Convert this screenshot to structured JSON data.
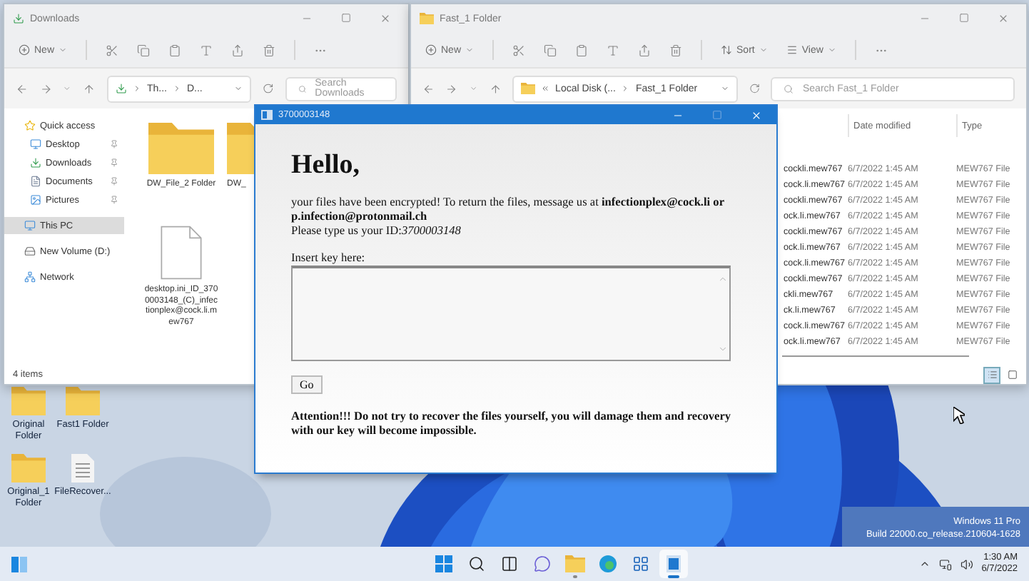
{
  "desktop": {
    "icons": [
      {
        "label": "Original Folder",
        "kind": "folder"
      },
      {
        "label": "Fast1 Folder",
        "kind": "folder"
      },
      {
        "label": "Original_1 Folder",
        "kind": "folder"
      },
      {
        "label": "FileRecover...",
        "kind": "document"
      }
    ],
    "watermark": [
      "Windows 11 Pro",
      "Build 22000.co_release.210604-1628"
    ]
  },
  "downloads_window": {
    "title": "Downloads",
    "new_button": "New",
    "address": [
      "Th...",
      "D..."
    ],
    "search": {
      "placeholder": "Search Downloads"
    },
    "nav": [
      {
        "label": "Quick access",
        "kind": "star",
        "pinned": false,
        "selected": false
      },
      {
        "label": "Desktop",
        "kind": "desktop",
        "pinned": true,
        "selected": false
      },
      {
        "label": "Downloads",
        "kind": "download",
        "pinned": true,
        "selected": false
      },
      {
        "label": "Documents",
        "kind": "document",
        "pinned": true,
        "selected": false
      },
      {
        "label": "Pictures",
        "kind": "pictures",
        "pinned": true,
        "selected": false
      },
      {
        "label": "This PC",
        "kind": "pc",
        "pinned": false,
        "selected": true
      },
      {
        "label": "New Volume (D:)",
        "kind": "drive",
        "pinned": false,
        "selected": false
      },
      {
        "label": "Network",
        "kind": "network",
        "pinned": false,
        "selected": false
      }
    ],
    "items": [
      {
        "label": "DW_File_2 Folder",
        "kind": "folder"
      },
      {
        "label": "DW_",
        "kind": "folder"
      },
      {
        "label": "desktop.ini_ID_3700003148_(C)_infectionplex@cock.li.mew767",
        "kind": "file"
      }
    ],
    "status": "4 items"
  },
  "fast_window": {
    "title": "Fast_1 Folder",
    "new_button": "New",
    "sort_button": "Sort",
    "view_button": "View",
    "address": [
      "Local Disk (...",
      "Fast_1 Folder"
    ],
    "search": {
      "placeholder": "Search Fast_1 Folder"
    },
    "columns": [
      "Date modified",
      "Type"
    ],
    "rows": [
      {
        "name": "cockli.mew767",
        "date": "6/7/2022 1:45 AM",
        "type": "MEW767 File"
      },
      {
        "name": "cock.li.mew767",
        "date": "6/7/2022 1:45 AM",
        "type": "MEW767 File"
      },
      {
        "name": "cockli.mew767",
        "date": "6/7/2022 1:45 AM",
        "type": "MEW767 File"
      },
      {
        "name": "ock.li.mew767",
        "date": "6/7/2022 1:45 AM",
        "type": "MEW767 File"
      },
      {
        "name": "cockli.mew767",
        "date": "6/7/2022 1:45 AM",
        "type": "MEW767 File"
      },
      {
        "name": "ock.li.mew767",
        "date": "6/7/2022 1:45 AM",
        "type": "MEW767 File"
      },
      {
        "name": "cock.li.mew767",
        "date": "6/7/2022 1:45 AM",
        "type": "MEW767 File"
      },
      {
        "name": "cockli.mew767",
        "date": "6/7/2022 1:45 AM",
        "type": "MEW767 File"
      },
      {
        "name": "ckli.mew767",
        "date": "6/7/2022 1:45 AM",
        "type": "MEW767 File"
      },
      {
        "name": "ck.li.mew767",
        "date": "6/7/2022 1:45 AM",
        "type": "MEW767 File"
      },
      {
        "name": "cock.li.mew767",
        "date": "6/7/2022 1:45 AM",
        "type": "MEW767 File"
      },
      {
        "name": "ock.li.mew767",
        "date": "6/7/2022 1:45 AM",
        "type": "MEW767 File"
      }
    ],
    "views": [
      {
        "kind": "details",
        "selected": true
      },
      {
        "kind": "tiles",
        "selected": false
      }
    ]
  },
  "dialog": {
    "title": "3700003148",
    "heading": "Hello,",
    "message": "your files have been encrypted! To return the files, message us at **infectionplex@cock.li or p.infection@protonmail.ch**",
    "id_line": "Please type us your ID:*3700003148*",
    "key_label": "Insert key here:",
    "button": "Go",
    "warning": "Attention!!! Do not try to recover the files yourself, you will damage them and recovery with our key will become impossible."
  },
  "taskbar": {
    "apps": [
      {
        "kind": "start",
        "running": false,
        "selected": false
      },
      {
        "kind": "search",
        "running": false,
        "selected": false
      },
      {
        "kind": "taskview",
        "running": false,
        "selected": false
      },
      {
        "kind": "chat",
        "running": false,
        "selected": false
      },
      {
        "kind": "explorer",
        "running": true,
        "selected": false
      },
      {
        "kind": "edge",
        "running": false,
        "selected": false
      },
      {
        "kind": "store",
        "running": false,
        "selected": false
      },
      {
        "kind": "app",
        "running": true,
        "selected": true
      }
    ],
    "time": "1:30 AM",
    "date": "6/7/2022"
  }
}
